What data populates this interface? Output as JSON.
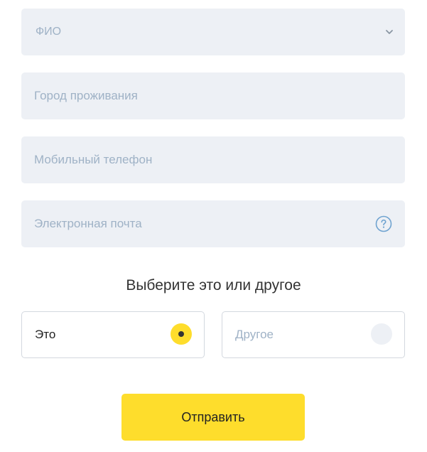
{
  "form": {
    "fio": {
      "label": "ФИО"
    },
    "city": {
      "placeholder": "Город проживания"
    },
    "phone": {
      "placeholder": "Мобильный телефон"
    },
    "email": {
      "placeholder": "Электронная почта"
    }
  },
  "choice": {
    "question": "Выберите это или другое",
    "options": [
      {
        "label": "Это",
        "selected": true
      },
      {
        "label": "Другое",
        "selected": false
      }
    ]
  },
  "submit_label": "Отправить",
  "colors": {
    "accent": "#fedd2c",
    "field_bg": "#edf0f5",
    "placeholder": "#9fb2c6",
    "help_icon": "#6fa3d0"
  },
  "icons": {
    "fio_dropdown": "chevron-down-icon",
    "email_help": "question-circle-icon"
  }
}
